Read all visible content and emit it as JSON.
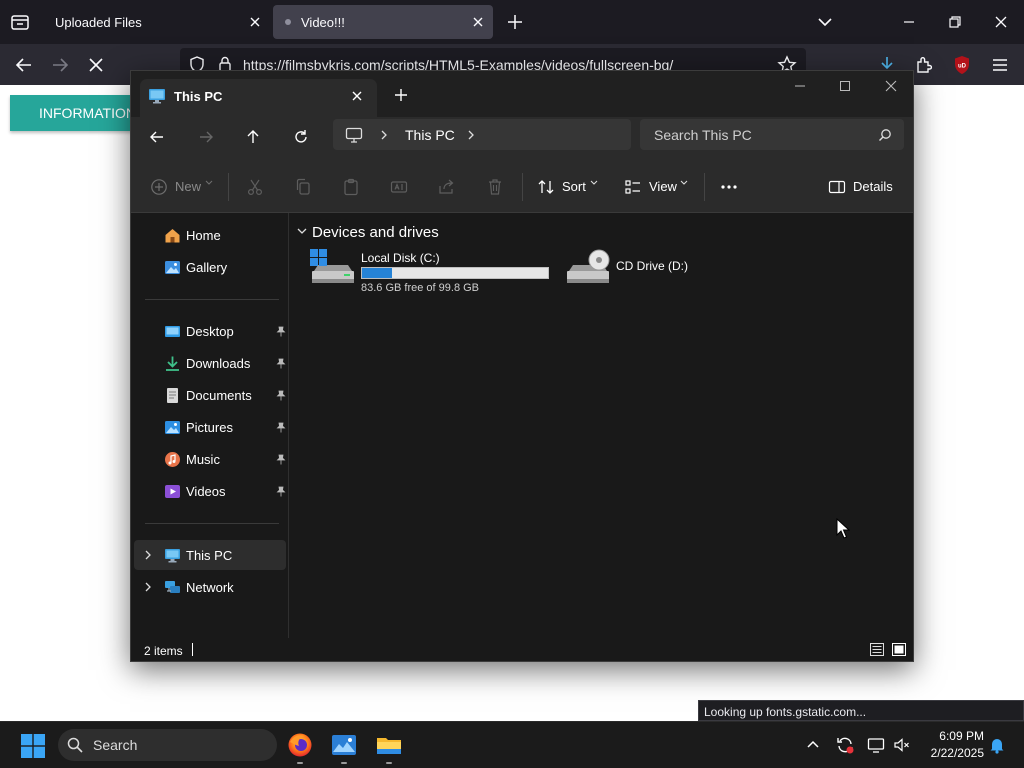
{
  "browser": {
    "tabs": [
      {
        "title": "Uploaded Files"
      },
      {
        "title": "Video!!!"
      }
    ],
    "url": "https://filmsbykris.com/scripts/HTML5-Examples/videos/fullscreen-bg/",
    "status_bubble": "Looking up fonts.gstatic.com..."
  },
  "page": {
    "info_button": "INFORMATION"
  },
  "explorer": {
    "tab_title": "This PC",
    "breadcrumb": "This PC",
    "search_placeholder": "Search This PC",
    "toolbar": {
      "new_label": "New",
      "sort_label": "Sort",
      "view_label": "View",
      "details_label": "Details"
    },
    "sidebar": {
      "top": [
        {
          "label": "Home",
          "icon": "home-icon"
        },
        {
          "label": "Gallery",
          "icon": "gallery-icon"
        }
      ],
      "quick_access": [
        {
          "label": "Desktop",
          "icon": "desktop-icon"
        },
        {
          "label": "Downloads",
          "icon": "downloads-icon"
        },
        {
          "label": "Documents",
          "icon": "documents-icon"
        },
        {
          "label": "Pictures",
          "icon": "pictures-icon"
        },
        {
          "label": "Music",
          "icon": "music-icon"
        },
        {
          "label": "Videos",
          "icon": "videos-icon"
        }
      ],
      "locations": [
        {
          "label": "This PC",
          "icon": "this-pc-icon",
          "selected": true
        },
        {
          "label": "Network",
          "icon": "network-icon",
          "selected": false
        }
      ]
    },
    "group_title": "Devices and drives",
    "drives": [
      {
        "name": "Local Disk (C:)",
        "free_text": "83.6 GB free of 99.8 GB",
        "used_fraction": 0.162
      },
      {
        "name": "CD Drive (D:)"
      }
    ],
    "status_text": "2 items"
  },
  "taskbar": {
    "search_label": "Search",
    "time": "6:09 PM",
    "date": "2/22/2025",
    "apps": [
      "firefox-icon",
      "photos-icon",
      "file-explorer-icon"
    ]
  },
  "colors": {
    "accent_teal": "#26a69a",
    "drive_bar_fill": "#2683d6",
    "explorer_bg": "#191919",
    "taskbar_bg": "#1b1b1b"
  }
}
